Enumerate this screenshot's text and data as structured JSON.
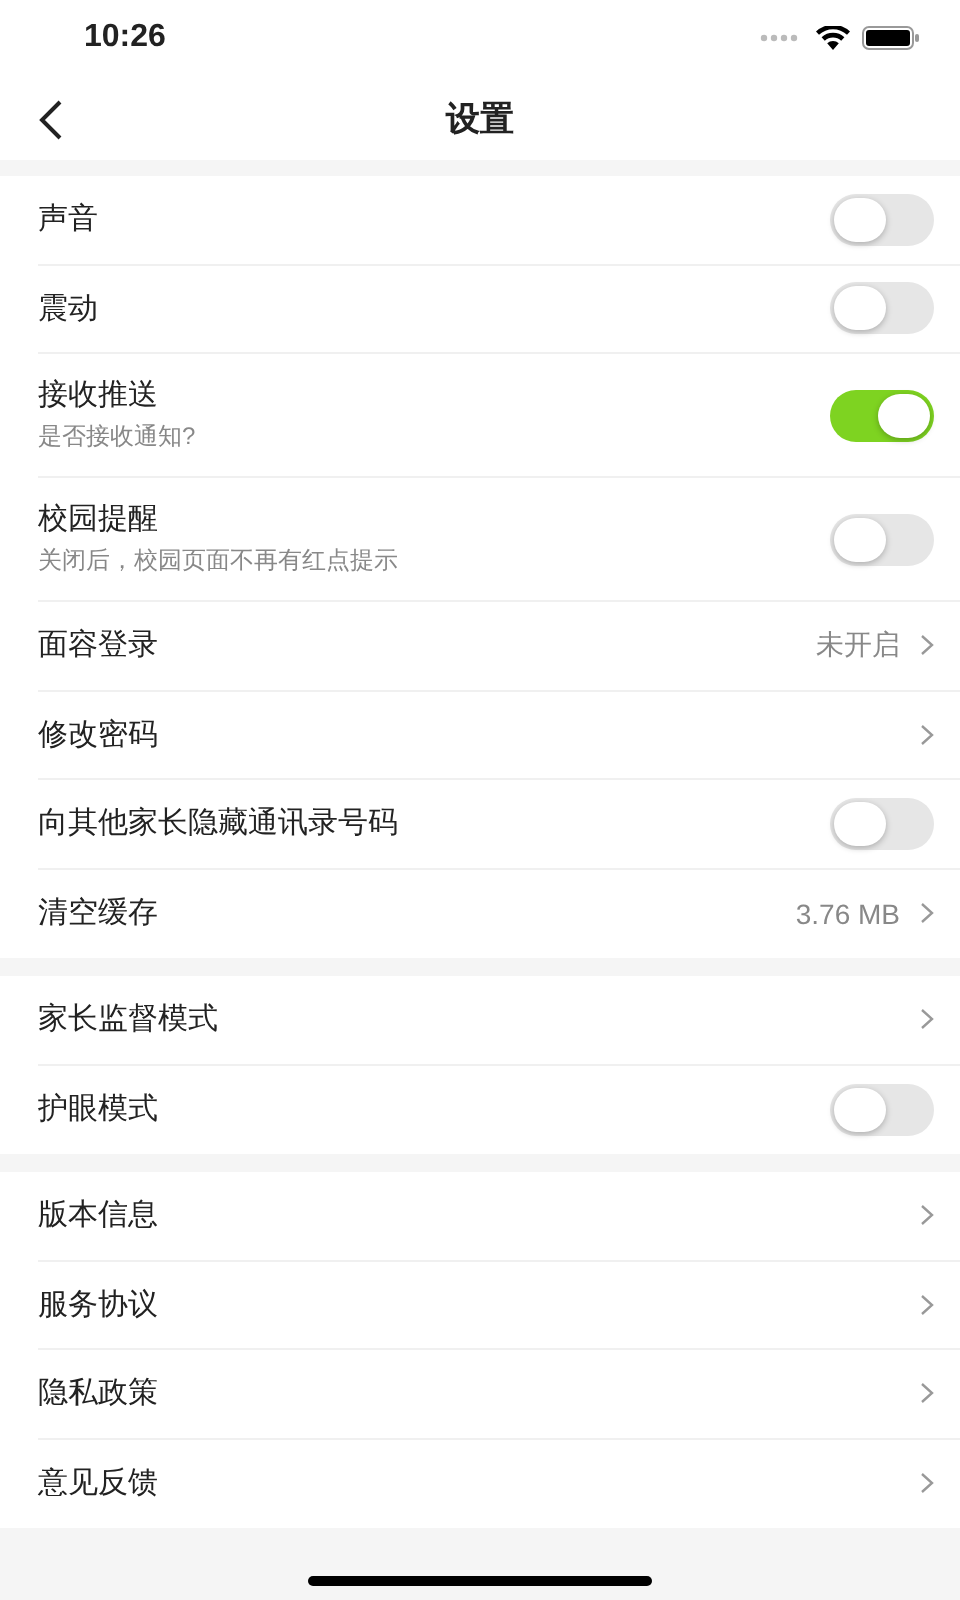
{
  "status_bar": {
    "time": "10:26"
  },
  "nav": {
    "title": "设置"
  },
  "groups": [
    {
      "rows": [
        {
          "kind": "toggle",
          "label": "声音",
          "on": false
        },
        {
          "kind": "toggle",
          "label": "震动",
          "on": false
        },
        {
          "kind": "toggle",
          "label": "接收推送",
          "subtitle": "是否接收通知?",
          "on": true
        },
        {
          "kind": "toggle",
          "label": "校园提醒",
          "subtitle": "关闭后，校园页面不再有红点提示",
          "on": false
        },
        {
          "kind": "link",
          "label": "面容登录",
          "value": "未开启"
        },
        {
          "kind": "link",
          "label": "修改密码"
        },
        {
          "kind": "toggle",
          "label": "向其他家长隐藏通讯录号码",
          "on": false
        },
        {
          "kind": "link",
          "label": "清空缓存",
          "value": "3.76 MB"
        }
      ]
    },
    {
      "rows": [
        {
          "kind": "link",
          "label": "家长监督模式"
        },
        {
          "kind": "toggle",
          "label": "护眼模式",
          "on": false
        }
      ]
    },
    {
      "rows": [
        {
          "kind": "link",
          "label": "版本信息"
        },
        {
          "kind": "link",
          "label": "服务协议"
        },
        {
          "kind": "link",
          "label": "隐私政策"
        },
        {
          "kind": "link",
          "label": "意见反馈"
        }
      ]
    }
  ]
}
